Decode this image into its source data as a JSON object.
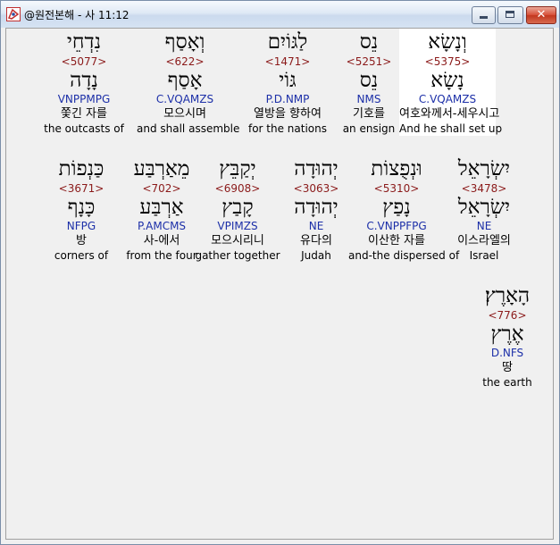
{
  "window": {
    "title": "@원전본해 - 사 11:12",
    "close_glyph": "✕"
  },
  "rows": [
    [
      {
        "hebrew": "וְנָשָׂא",
        "strong": "<5375>",
        "lexeme": "נָשָׂא",
        "parsing": "C.VQAMZS",
        "korean": "여호와께서-세우시고",
        "english": "And he shall set up",
        "highlight": true
      },
      {
        "hebrew": "נֵס",
        "strong": "<5251>",
        "lexeme": "נֵס",
        "parsing": "NMS",
        "korean": "기호를",
        "english": "an ensign"
      },
      {
        "hebrew": "לַגּוֹיִם",
        "strong": "<1471>",
        "lexeme": "גּוֹי",
        "parsing": "P.D.NMP",
        "korean": "열방을 향하여",
        "english": "for the nations"
      },
      {
        "hebrew": "וְאָסַף",
        "strong": "<622>",
        "lexeme": "אָסַף",
        "parsing": "C.VQAMZS",
        "korean": "모으시며",
        "english": "and shall assemble"
      },
      {
        "hebrew": "נִדְחֵי",
        "strong": "<5077>",
        "lexeme": "נָדָה",
        "parsing": "VNPPMPG",
        "korean": "쫓긴 자를",
        "english": "the outcasts of"
      }
    ],
    [
      {
        "hebrew": "יִשְׂרָאֵל",
        "strong": "<3478>",
        "lexeme": "יִשְׂרָאֵל",
        "parsing": "NE",
        "korean": "이스라엘의",
        "english": "Israel"
      },
      {
        "hebrew": "וּנְפֻצוֹת",
        "strong": "<5310>",
        "lexeme": "נָפַץ",
        "parsing": "C.VNPPFPG",
        "korean": "이산한 자를",
        "english": "and-the dispersed of"
      },
      {
        "hebrew": "יְהוּדָה",
        "strong": "<3063>",
        "lexeme": "יְהוּדָה",
        "parsing": "NE",
        "korean": "유다의",
        "english": "Judah"
      },
      {
        "hebrew": "יְקַבֵּץ",
        "strong": "<6908>",
        "lexeme": "קָבַץ",
        "parsing": "VPIMZS",
        "korean": "모으시리니",
        "english": "gather together"
      },
      {
        "hebrew": "מֵאַרְבַּע",
        "strong": "<702>",
        "lexeme": "אַרְבַּע",
        "parsing": "P.AMCMS",
        "korean": "사-에서",
        "english": "from the four"
      },
      {
        "hebrew": "כַּנְפוֹת",
        "strong": "<3671>",
        "lexeme": "כָּנָף",
        "parsing": "NFPG",
        "korean": "방",
        "english": "corners of"
      }
    ],
    [
      {
        "hebrew": "הָאָרֶץ׃",
        "strong": "<776>",
        "lexeme": "אֶרֶץ",
        "parsing": "D.NFS",
        "korean": "땅",
        "english": "the earth"
      }
    ]
  ]
}
